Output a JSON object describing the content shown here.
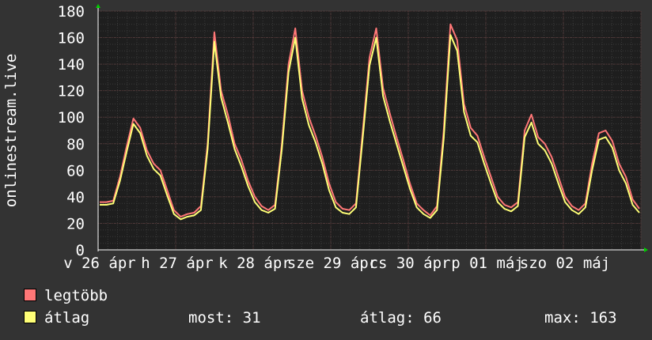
{
  "chart_data": {
    "type": "area",
    "ylabel": "onlinestream.live",
    "ylim": [
      0,
      180
    ],
    "yticks": [
      0,
      20,
      40,
      60,
      80,
      100,
      120,
      140,
      160,
      180
    ],
    "grid": true,
    "x_tick_labels": [
      "v 26 ápr",
      "h 27 ápr",
      "k 28 ápr",
      "sze 29 ápr",
      "cs 30 ápr",
      "p 01 máj",
      "szo 02 máj"
    ],
    "series": [
      {
        "name": "legtöbb",
        "color": "#ff7777",
        "values": [
          36,
          36,
          37,
          55,
          78,
          99,
          92,
          75,
          65,
          60,
          45,
          30,
          25,
          27,
          28,
          33,
          80,
          164,
          120,
          102,
          80,
          68,
          52,
          40,
          33,
          30,
          34,
          80,
          140,
          167,
          120,
          100,
          86,
          70,
          50,
          36,
          31,
          30,
          35,
          90,
          145,
          167,
          122,
          103,
          85,
          68,
          50,
          35,
          30,
          26,
          33,
          90,
          170,
          158,
          110,
          92,
          86,
          70,
          55,
          40,
          34,
          32,
          36,
          90,
          102,
          85,
          80,
          70,
          55,
          40,
          33,
          30,
          35,
          65,
          88,
          90,
          82,
          65,
          55,
          38,
          31
        ]
      },
      {
        "name": "átlag",
        "color": "#ffff77",
        "values": [
          34,
          34,
          35,
          52,
          74,
          95,
          88,
          71,
          61,
          56,
          41,
          27,
          23,
          25,
          26,
          30,
          76,
          157,
          115,
          96,
          76,
          63,
          48,
          36,
          30,
          28,
          31,
          76,
          134,
          160,
          114,
          94,
          81,
          65,
          45,
          32,
          28,
          27,
          32,
          85,
          139,
          160,
          116,
          97,
          80,
          63,
          46,
          32,
          27,
          24,
          30,
          84,
          162,
          150,
          104,
          86,
          81,
          65,
          50,
          36,
          31,
          29,
          33,
          85,
          96,
          80,
          75,
          65,
          50,
          36,
          30,
          27,
          32,
          60,
          83,
          85,
          77,
          60,
          50,
          34,
          28
        ]
      }
    ],
    "legend": [
      {
        "label": "legtöbb",
        "color": "#ff7777"
      },
      {
        "label": "átlag",
        "color": "#ffff77"
      }
    ],
    "stats": {
      "now_label": "most:",
      "now_value": "31",
      "avg_label": "átlag:",
      "avg_value": "66",
      "max_label": "max:",
      "max_value": "163"
    }
  }
}
